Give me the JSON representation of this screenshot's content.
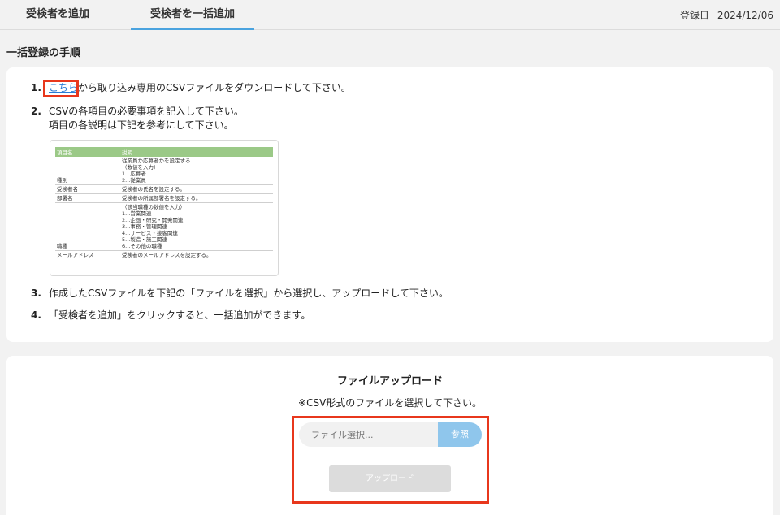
{
  "tabs": [
    {
      "label": "受検者を追加"
    },
    {
      "label": "受検者を一括追加"
    }
  ],
  "reg_date": {
    "label": "登録日",
    "value": "2024/12/06"
  },
  "section_title": "一括登録の手順",
  "steps": {
    "s1": {
      "num": "1.",
      "link": "こちら",
      "text": "から取り込み専用のCSVファイルをダウンロードして下さい。"
    },
    "s2": {
      "num": "2.",
      "line1": "CSVの各項目の必要事項を記入して下さい。",
      "line2": "項目の各説明は下記を参考にして下さい。"
    },
    "s3": {
      "num": "3.",
      "text": "作成したCSVファイルを下記の「ファイルを選択」から選択し、アップロードして下さい。"
    },
    "s4": {
      "num": "4.",
      "text": "「受検者を追加」をクリックすると、一括追加ができます。"
    }
  },
  "ref_table": {
    "headers": [
      "項目名",
      "説明"
    ],
    "rows": [
      {
        "name": "種別",
        "desc": "従業員か応募者かを設定する\n（数値を入力）\n1...応募者\n2...従業員"
      },
      {
        "name": "受検者名",
        "desc": "受検者の氏名を設定する。"
      },
      {
        "name": "部署名",
        "desc": "受検者の所属部署名を設定する。"
      },
      {
        "name": "職種",
        "desc": "（該当職種の数値を入力）\n1...営業関連\n2...企画・研究・開発関連\n3...事務・管理関連\n4...サービス・接客関連\n5...製造・施工関連\n6...その他の職種"
      },
      {
        "name": "メールアドレス",
        "desc": "受検者のメールアドレスを設定する。"
      }
    ]
  },
  "upload": {
    "title": "ファイルアップロード",
    "note": "※CSV形式のファイルを選択して下さい。",
    "file_placeholder": "ファイル選択...",
    "browse_label": "参照",
    "upload_label": "アップロード"
  },
  "colors": {
    "accent": "#4aa3df",
    "highlight": "#e8371c",
    "table_header": "#9bc987",
    "browse": "#8fc6ec"
  }
}
